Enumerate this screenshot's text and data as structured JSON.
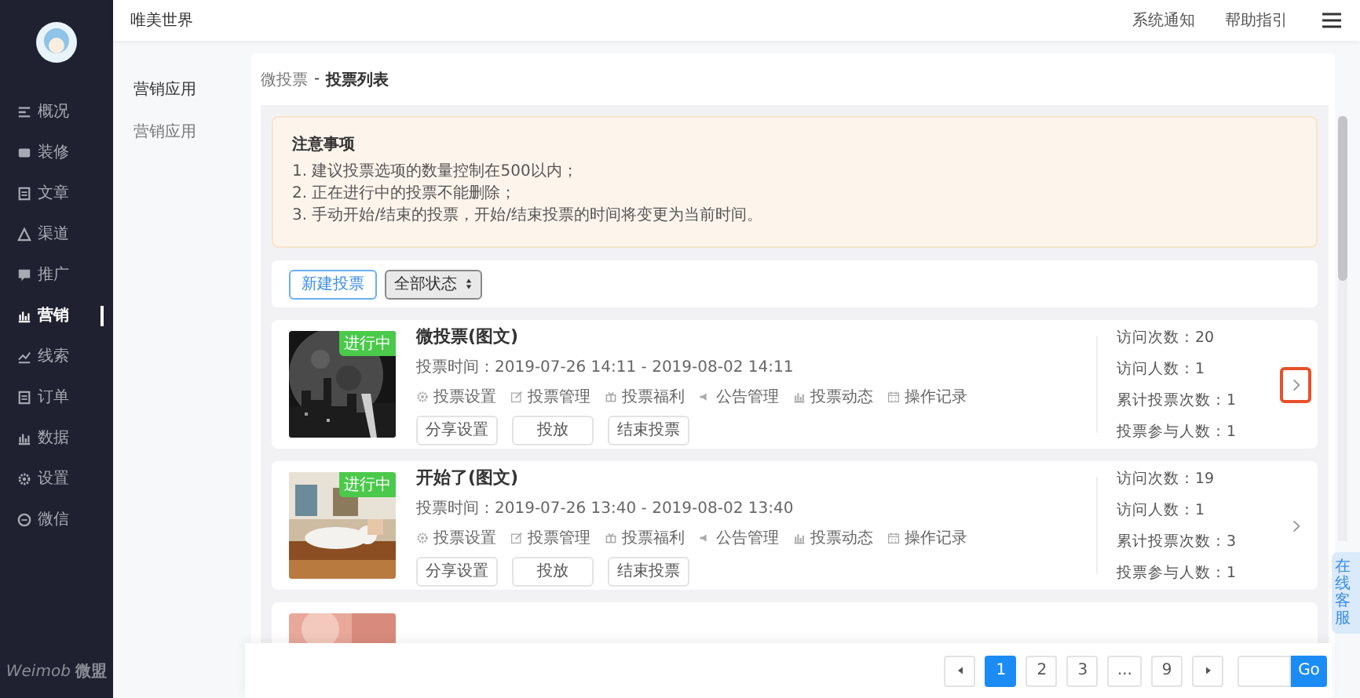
{
  "sidebar": {
    "items": [
      {
        "label": "概况",
        "selected": false
      },
      {
        "label": "装修",
        "selected": false
      },
      {
        "label": "文章",
        "selected": false
      },
      {
        "label": "渠道",
        "selected": false
      },
      {
        "label": "推广",
        "selected": false
      },
      {
        "label": "营销",
        "selected": true
      },
      {
        "label": "线索",
        "selected": false
      },
      {
        "label": "订单",
        "selected": false
      },
      {
        "label": "数据",
        "selected": false
      },
      {
        "label": "设置",
        "selected": false
      },
      {
        "label": "微信",
        "selected": false
      }
    ],
    "logo": {
      "brand": "Weimob",
      "brand_cn": "微盟"
    }
  },
  "topbar": {
    "title": "唯美世界",
    "links": [
      "系统通知",
      "帮助指引"
    ]
  },
  "subnav": {
    "items": [
      {
        "label": "营销应用",
        "selected": true
      },
      {
        "label": "营销应用",
        "selected": false
      }
    ]
  },
  "breadcrumb": {
    "parent": "微投票",
    "separator": "-",
    "current": "投票列表"
  },
  "notice": {
    "title": "注意事项",
    "lines": [
      "1. 建议投票选项的数量控制在500以内；",
      "2. 正在进行中的投票不能删除；",
      "3. 手动开始/结束的投票，开始/结束投票的时间将变更为当前时间。"
    ]
  },
  "toolbar": {
    "new_button": "新建投票",
    "filter": "全部状态"
  },
  "polls": [
    {
      "title": "微投票(图文)",
      "status": "进行中",
      "kind": "picture",
      "time_label": "投票时间：",
      "time": "2019-07-26 14:11 - 2019-08-02 14:11",
      "actions": [
        "投票设置",
        "投票管理",
        "投票福利",
        "公告管理",
        "投票动态",
        "操作记录"
      ],
      "buttons": [
        "分享设置",
        "投放",
        "结束投票"
      ],
      "stats": [
        {
          "label": "访问次数：",
          "value": "20"
        },
        {
          "label": "访问人数：",
          "value": "1"
        },
        {
          "label": "累计投票次数：",
          "value": "1"
        },
        {
          "label": "投票参与人数：",
          "value": "1"
        }
      ],
      "selected": true
    },
    {
      "title": "开始了(图文)",
      "status": "进行中",
      "kind": "picture",
      "time_label": "投票时间：",
      "time": "2019-07-26 13:40 - 2019-08-02 13:40",
      "actions": [
        "投票设置",
        "投票管理",
        "投票福利",
        "公告管理",
        "投票动态",
        "操作记录"
      ],
      "buttons": [
        "分享设置",
        "投放",
        "结束投票"
      ],
      "stats": [
        {
          "label": "访问次数：",
          "value": "19"
        },
        {
          "label": "访问人数：",
          "value": "1"
        },
        {
          "label": "累计投票次数：",
          "value": "3"
        },
        {
          "label": "投票参与人数：",
          "value": "1"
        }
      ],
      "selected": false
    },
    {
      "kind": "picture"
    }
  ],
  "pagination": {
    "pages": [
      {
        "label": "1",
        "selected": true
      },
      {
        "label": "2",
        "selected": false
      },
      {
        "label": "3",
        "selected": false
      },
      {
        "label": "...",
        "selected": false
      },
      {
        "label": "9",
        "selected": false
      }
    ],
    "go": "Go"
  },
  "service_tab": "在线客服"
}
